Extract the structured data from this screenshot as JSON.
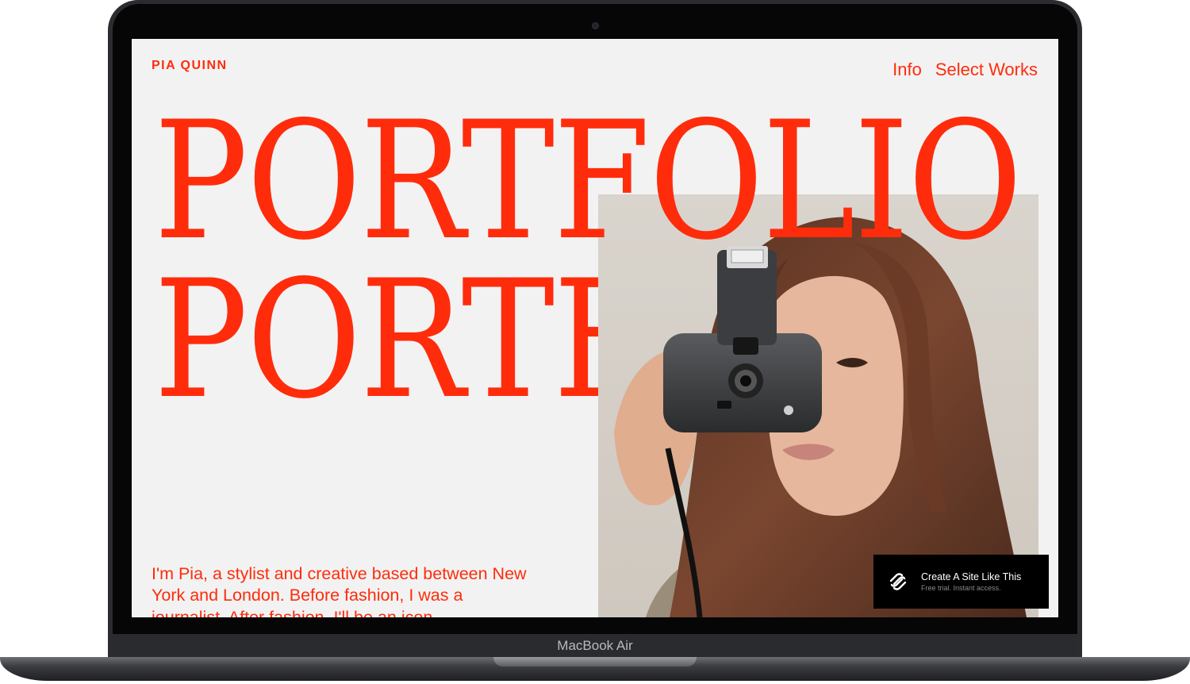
{
  "device": {
    "label": "MacBook Air"
  },
  "site": {
    "brand": "PIA QUINN",
    "nav": [
      {
        "label": "Info"
      },
      {
        "label": "Select Works"
      }
    ],
    "hero": {
      "line1": "PORTFOLIO",
      "line2": "PORTFOLIO"
    },
    "bio": "I'm Pia, a stylist and creative based between New York and London. Before fashion, I was a journalist. After fashion, I'll be an icon.",
    "accent_color": "#ff2c0c"
  },
  "cta_badge": {
    "title": "Create A Site Like This",
    "subtitle": "Free trial. Instant access.",
    "icon": "squarespace-logo-icon"
  },
  "photo": {
    "icon": "portrait-with-camera-photo"
  }
}
